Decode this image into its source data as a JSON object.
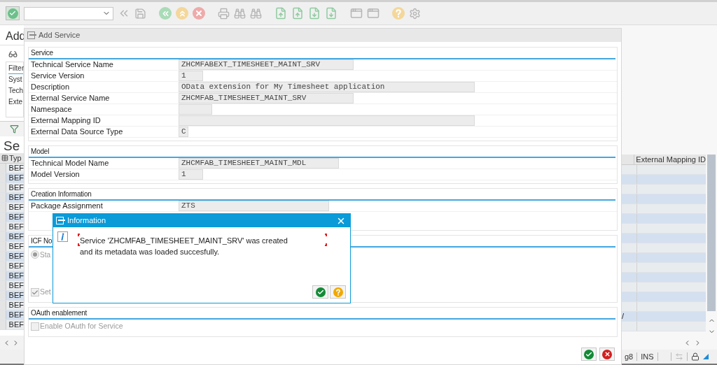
{
  "screen": {
    "title": "Add",
    "filter": {
      "title": "Filter",
      "labels": [
        "Syst",
        "Tech",
        "Exte"
      ]
    },
    "table": {
      "title": "Se",
      "columns": [
        "Typ",
        "External Mapping ID"
      ],
      "rows": [
        {
          "type": "BEF"
        },
        {
          "type": "BEF"
        },
        {
          "type": "BEF"
        },
        {
          "type": "BEF"
        },
        {
          "type": "BEF"
        },
        {
          "type": "BEF"
        },
        {
          "type": "BEF"
        },
        {
          "type": "BEF"
        },
        {
          "type": "BEF"
        },
        {
          "type": "BEF"
        },
        {
          "type": "BEF"
        },
        {
          "type": "BEF"
        },
        {
          "type": "BEF"
        },
        {
          "type": "BEF"
        },
        {
          "type": "BEF"
        },
        {
          "type": "BEF",
          "column_3": "/"
        },
        {
          "type": "BEF"
        }
      ]
    }
  },
  "status_bar": {
    "session": "g8",
    "mode": "INS"
  },
  "dialog": {
    "title": "Add Service",
    "sections": [
      {
        "title": "Service",
        "fields": [
          {
            "kind": "text",
            "label": "Technical Service Name",
            "value": "ZHCMFABEXT_TIMESHEET_MAINT_SRV"
          },
          {
            "kind": "text",
            "label": "Service Version",
            "value": "1"
          },
          {
            "kind": "text",
            "label": "Description",
            "value": "OData extension for My Timesheet application"
          },
          {
            "kind": "text",
            "label": "External Service Name",
            "value": "ZHCMFAB_TIMESHEET_MAINT_SRV"
          },
          {
            "kind": "text",
            "label": "Namespace"
          },
          {
            "kind": "text",
            "label": "External Mapping ID"
          },
          {
            "kind": "text",
            "label": "External Data Source Type",
            "value": "C"
          }
        ]
      },
      {
        "title": "Model",
        "fields": [
          {
            "kind": "text",
            "label": "Technical Model Name",
            "value": "ZHCMFAB_TIMESHEET_MAINT_MDL"
          },
          {
            "kind": "text",
            "label": "Model Version",
            "value": "1"
          }
        ]
      },
      {
        "title": "Creation Information",
        "fields": [
          {
            "kind": "text",
            "label": "Package Assignment",
            "value": "ZTS"
          },
          {
            "kind": "blank"
          }
        ]
      },
      {
        "title": "ICF No",
        "fields": [
          {
            "kind": "radio",
            "label": "Sta",
            "selected": true,
            "disabled": true
          },
          {
            "kind": "gap"
          },
          {
            "kind": "checkbox",
            "label": "Set",
            "checked": true,
            "disabled": true
          }
        ]
      },
      {
        "title": "OAuth enablement",
        "fields": [
          {
            "kind": "checkbox",
            "label": "Enable OAuth for Service",
            "checked": false,
            "disabled": true
          }
        ]
      }
    ]
  },
  "popup": {
    "title": "Information",
    "lines": [
      "Service 'ZHCMFAB_TIMESHEET_MAINT_SRV' was created",
      "and its metadata was loaded succesfully."
    ]
  }
}
